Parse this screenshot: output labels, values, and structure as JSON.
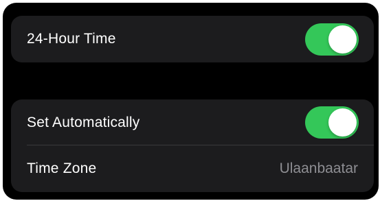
{
  "time_format": {
    "label": "24-Hour Time",
    "toggle_on": true
  },
  "date_time": {
    "set_automatically_label": "Set Automatically",
    "set_automatically_on": true,
    "time_zone_label": "Time Zone",
    "time_zone_value": "Ulaanbaatar"
  },
  "colors": {
    "toggle_on": "#34c759",
    "background": "#000000",
    "group_background": "#1c1c1e",
    "secondary_text": "#8e8e93"
  }
}
